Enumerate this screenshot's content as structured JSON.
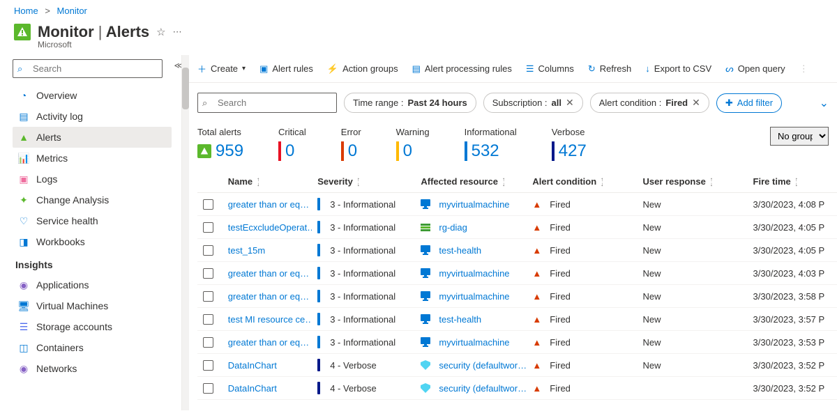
{
  "breadcrumb": {
    "home": "Home",
    "current": "Monitor"
  },
  "header": {
    "title": "Monitor",
    "section": "Alerts",
    "sub": "Microsoft"
  },
  "sidebar": {
    "search_placeholder": "Search",
    "items": [
      {
        "label": "Overview",
        "color": "#0078d4"
      },
      {
        "label": "Activity log",
        "color": "#0078d4"
      },
      {
        "label": "Alerts",
        "color": "#5bb82c",
        "active": true
      },
      {
        "label": "Metrics",
        "color": "#0078d4"
      },
      {
        "label": "Logs",
        "color": "#ef6f9f"
      },
      {
        "label": "Change Analysis",
        "color": "#5bb82c"
      },
      {
        "label": "Service health",
        "color": "#0078d4"
      },
      {
        "label": "Workbooks",
        "color": "#0078d4"
      }
    ],
    "group": "Insights",
    "insights": [
      {
        "label": "Applications",
        "color": "#8661c5"
      },
      {
        "label": "Virtual Machines",
        "color": "#0078d4"
      },
      {
        "label": "Storage accounts",
        "color": "#4f6bed"
      },
      {
        "label": "Containers",
        "color": "#0078d4"
      },
      {
        "label": "Networks",
        "color": "#8661c5"
      }
    ]
  },
  "toolbar": {
    "create": "Create",
    "rules": "Alert rules",
    "groups": "Action groups",
    "processing": "Alert processing rules",
    "columns": "Columns",
    "refresh": "Refresh",
    "export": "Export to CSV",
    "open": "Open query"
  },
  "filters": {
    "search_placeholder": "Search",
    "chips": [
      {
        "label": "Time range : ",
        "value": "Past 24 hours",
        "close": false
      },
      {
        "label": "Subscription : ",
        "value": "all",
        "close": true
      },
      {
        "label": "Alert condition : ",
        "value": "Fired",
        "close": true
      }
    ],
    "add": "Add filter"
  },
  "summary": [
    {
      "label": "Total alerts",
      "value": "959",
      "color": "#5bb82c",
      "icon": true
    },
    {
      "label": "Critical",
      "value": "0",
      "color": "#e81123"
    },
    {
      "label": "Error",
      "value": "0",
      "color": "#da3b01"
    },
    {
      "label": "Warning",
      "value": "0",
      "color": "#ffb900"
    },
    {
      "label": "Informational",
      "value": "532",
      "color": "#0078d4"
    },
    {
      "label": "Verbose",
      "value": "427",
      "color": "#05198a"
    }
  ],
  "grouping": "No grouping",
  "columns": [
    "Name",
    "Severity",
    "Affected resource",
    "Alert condition",
    "User response",
    "Fire time"
  ],
  "rows": [
    {
      "name": "greater than or eq…",
      "sev": "3 - Informational",
      "sevc": "#0078d4",
      "res": "myvirtualmachine",
      "restype": "vm",
      "cond": "Fired",
      "user": "New",
      "time": "3/30/2023, 4:08 P"
    },
    {
      "name": "testEcxcludeOperat…",
      "sev": "3 - Informational",
      "sevc": "#0078d4",
      "res": "rg-diag",
      "restype": "rg",
      "cond": "Fired",
      "user": "New",
      "time": "3/30/2023, 4:05 P"
    },
    {
      "name": "test_15m",
      "sev": "3 - Informational",
      "sevc": "#0078d4",
      "res": "test-health",
      "restype": "vm",
      "cond": "Fired",
      "user": "New",
      "time": "3/30/2023, 4:05 P"
    },
    {
      "name": "greater than or eq…",
      "sev": "3 - Informational",
      "sevc": "#0078d4",
      "res": "myvirtualmachine",
      "restype": "vm",
      "cond": "Fired",
      "user": "New",
      "time": "3/30/2023, 4:03 P"
    },
    {
      "name": "greater than or eq…",
      "sev": "3 - Informational",
      "sevc": "#0078d4",
      "res": "myvirtualmachine",
      "restype": "vm",
      "cond": "Fired",
      "user": "New",
      "time": "3/30/2023, 3:58 P"
    },
    {
      "name": "test MI resource ce…",
      "sev": "3 - Informational",
      "sevc": "#0078d4",
      "res": "test-health",
      "restype": "vm",
      "cond": "Fired",
      "user": "New",
      "time": "3/30/2023, 3:57 P"
    },
    {
      "name": "greater than or eq…",
      "sev": "3 - Informational",
      "sevc": "#0078d4",
      "res": "myvirtualmachine",
      "restype": "vm",
      "cond": "Fired",
      "user": "New",
      "time": "3/30/2023, 3:53 P"
    },
    {
      "name": "DataInChart",
      "sev": "4 - Verbose",
      "sevc": "#05198a",
      "res": "security (defaultwor…",
      "restype": "sec",
      "cond": "Fired",
      "user": "New",
      "time": "3/30/2023, 3:52 P"
    },
    {
      "name": "DataInChart",
      "sev": "4 - Verbose",
      "sevc": "#05198a",
      "res": "security (defaultwor…",
      "restype": "sec",
      "cond": "Fired",
      "user": "",
      "time": "3/30/2023, 3:52 P"
    }
  ]
}
